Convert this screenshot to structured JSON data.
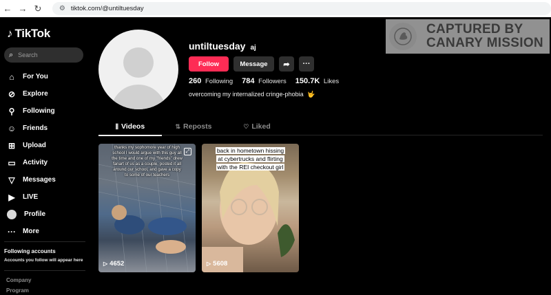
{
  "browser": {
    "back": "←",
    "forward": "→",
    "reload": "↻",
    "url": "tiktok.com/@untiltuesday"
  },
  "sidebar": {
    "logo": "TikTok",
    "search_placeholder": "Search",
    "items": [
      {
        "label": "For You",
        "icon": "home-icon"
      },
      {
        "label": "Explore",
        "icon": "compass-icon"
      },
      {
        "label": "Following",
        "icon": "user-plus-icon"
      },
      {
        "label": "Friends",
        "icon": "friends-icon"
      },
      {
        "label": "Upload",
        "icon": "plus-square-icon"
      },
      {
        "label": "Activity",
        "icon": "message-box-icon"
      },
      {
        "label": "Messages",
        "icon": "send-icon"
      },
      {
        "label": "LIVE",
        "icon": "live-icon"
      },
      {
        "label": "Profile",
        "icon": "avatar"
      },
      {
        "label": "More",
        "icon": "more-dots-icon"
      }
    ],
    "following_title": "Following accounts",
    "following_sub": "Accounts you follow will appear here",
    "footer": [
      "Company",
      "Program"
    ]
  },
  "profile": {
    "username": "untiltuesday",
    "nickname": "aj",
    "follow_label": "Follow",
    "message_label": "Message",
    "stats": {
      "following_count": "260",
      "following_label": "Following",
      "followers_count": "784",
      "followers_label": "Followers",
      "likes_count": "150.7K",
      "likes_label": "Likes"
    },
    "bio": "overcoming my internalized cringe-phobia",
    "bio_emoji": "🤟"
  },
  "tabs": [
    {
      "label": "Videos",
      "active": true
    },
    {
      "label": "Reposts",
      "active": false
    },
    {
      "label": "Liked",
      "active": false
    }
  ],
  "videos": [
    {
      "views": "4652",
      "caption": "thanks my sophomore year of high school I would argue with this guy all the time and one of my \"friends\" drew fanart of us as a couple, posted it all around our school, and gave a copy to some of our teachers"
    },
    {
      "views": "5608",
      "caption_lines": [
        "back in hometown hissing",
        "at cybertrucks and flirting",
        "with the REI checkout girl"
      ]
    }
  ],
  "watermark": {
    "line1": "CAPTURED BY",
    "line2": "CANARY MISSION"
  },
  "colors": {
    "follow": "#fe2c55",
    "background": "#000000",
    "button_dark": "#2f2f2f"
  }
}
